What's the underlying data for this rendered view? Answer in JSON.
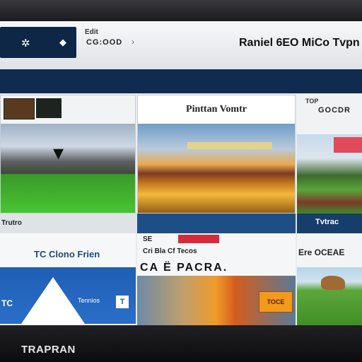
{
  "header": {
    "nav_small": "Edit",
    "nav_code": "CG:OOD",
    "title": "Raniel 6EO MiCo Tvpn"
  },
  "tiles": {
    "featured": {
      "caption": "Pinttan Vomtr"
    },
    "side_top": {
      "small": "TOP",
      "code": "GOCDR"
    },
    "strip_left": "Trutro",
    "strip_right": "Tvtrac",
    "bottom_left": {
      "title": "TC Clono Frien",
      "tag1": "TC",
      "tag2": "Tennios",
      "tag3": "T"
    },
    "bottom_mid": {
      "row1": "SE",
      "row2": "Cri Bla Cf Tecos",
      "row3": "CA Ë PACRA.",
      "badge": "TOCE"
    },
    "bottom_right": {
      "title": "Ere OCEAE"
    }
  },
  "brand": "TRAPRAN",
  "icons": [
    "settings-icon",
    "search-icon",
    "arrow-icon"
  ]
}
